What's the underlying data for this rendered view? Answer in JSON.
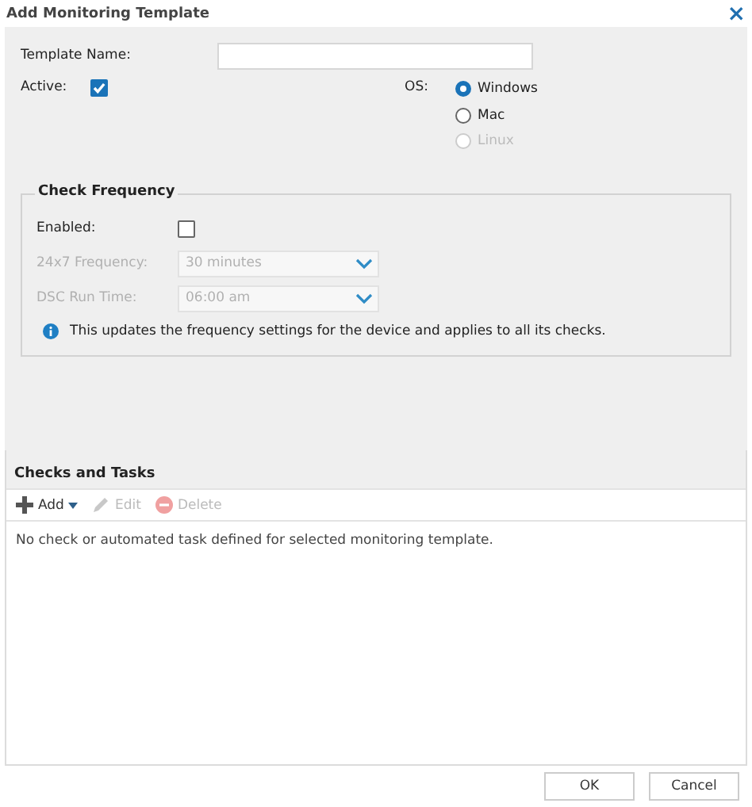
{
  "window": {
    "title": "Add Monitoring Template",
    "close": "×"
  },
  "template_name": {
    "label": "Template Name:"
  },
  "active": {
    "label": "Active:",
    "checked": true
  },
  "os": {
    "label": "OS:",
    "options": [
      {
        "label": "Windows",
        "selected": true,
        "disabled": false
      },
      {
        "label": "Mac",
        "selected": false,
        "disabled": false
      },
      {
        "label": "Linux",
        "selected": false,
        "disabled": true
      }
    ]
  },
  "check_frequency": {
    "title": "Check Frequency",
    "enabled": {
      "label": "Enabled:",
      "checked": false
    },
    "fields": [
      {
        "label": "24x7 Frequency:",
        "value": "30 minutes",
        "disabled": true
      },
      {
        "label": "DSC Run Time:",
        "value": "06:00 am",
        "disabled": true
      }
    ],
    "info": "This updates the frequency settings for the device and applies to all its checks."
  },
  "checks_and_tasks": {
    "title": "Checks and Tasks",
    "toolbar": [
      {
        "kind": "add",
        "label": "Add",
        "disabled": false
      },
      {
        "kind": "edit",
        "label": "Edit",
        "disabled": true
      },
      {
        "kind": "delete",
        "label": "Delete",
        "disabled": true
      }
    ],
    "empty_message": "No check or automated task defined for selected monitoring template."
  },
  "buttons": [
    {
      "label": "OK"
    },
    {
      "label": "Cancel"
    }
  ]
}
